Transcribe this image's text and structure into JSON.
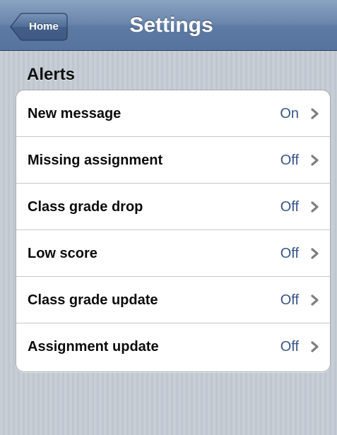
{
  "navbar": {
    "back_label": "Home",
    "title": "Settings",
    "back_icon": "back-arrow-icon"
  },
  "section": {
    "header": "Alerts"
  },
  "alerts": [
    {
      "label": "New message",
      "value": "On"
    },
    {
      "label": "Missing assignment",
      "value": "Off"
    },
    {
      "label": "Class grade drop",
      "value": "Off"
    },
    {
      "label": "Low score",
      "value": "Off"
    },
    {
      "label": "Class grade update",
      "value": "Off"
    },
    {
      "label": "Assignment update",
      "value": "Off"
    }
  ],
  "colors": {
    "navbar": "#6985ab",
    "value_text": "#385487",
    "background": "#c5ccd4",
    "chevron": "#7f7f7f"
  }
}
